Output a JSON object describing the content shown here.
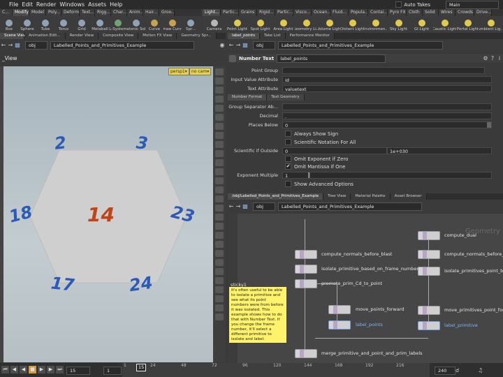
{
  "menu": {
    "items": [
      "File",
      "Edit",
      "Render",
      "Windows",
      "Assets",
      "Help"
    ],
    "auto_takes": "Auto Takes",
    "desktop": "Main"
  },
  "shelf_tabs_left": [
    "C...",
    "Modify",
    "Model",
    "Poly...",
    "Deform",
    "Text...",
    "Rigg...",
    "Char...",
    "Anim...",
    "Hair...",
    "Groo..."
  ],
  "shelf_tabs_right": [
    "Light...",
    "Partic...",
    "Grains",
    "Rigid...",
    "Partic...",
    "Visco...",
    "Ocean...",
    "Fluid...",
    "Popula...",
    "Contai...",
    "Pyro FX",
    "Cloth",
    "Solid",
    "Wires",
    "Crowds",
    "Drive..."
  ],
  "tools_left": [
    {
      "label": "Box",
      "color": "#8fa2b8"
    },
    {
      "label": "Sphere",
      "color": "#8fa2b8"
    },
    {
      "label": "Tube",
      "color": "#8fa2b8"
    },
    {
      "label": "Torus",
      "color": "#8fa2b8"
    },
    {
      "label": "Grid",
      "color": "#8fa2b8"
    },
    {
      "label": "Metaball",
      "color": "#8fa2b8"
    },
    {
      "label": "L-System",
      "color": "#6fa36f"
    },
    {
      "label": "Platonic Sol...",
      "color": "#8fa2b8"
    },
    {
      "label": "Curve",
      "color": "#c7a34a"
    },
    {
      "label": "Draw Curve",
      "color": "#c7a34a"
    },
    {
      "label": "Spr...",
      "color": "#8fa2b8"
    }
  ],
  "tools_right": [
    {
      "label": "Camera",
      "color": "#b8b8b8"
    },
    {
      "label": "Point Light",
      "color": "#e2c84c"
    },
    {
      "label": "Spot Light",
      "color": "#e2c84c"
    },
    {
      "label": "Area Light",
      "color": "#e2c84c"
    },
    {
      "label": "Geometry Li...",
      "color": "#e2c84c"
    },
    {
      "label": "Volume Light",
      "color": "#e2c84c"
    },
    {
      "label": "Distant Light",
      "color": "#e2c84c"
    },
    {
      "label": "Environmen...",
      "color": "#e2c84c"
    },
    {
      "label": "Sky Light",
      "color": "#e2c84c"
    },
    {
      "label": "GI Light",
      "color": "#e2c84c"
    },
    {
      "label": "Caustic Light",
      "color": "#e2c84c"
    },
    {
      "label": "Portal Light",
      "color": "#e2c84c"
    },
    {
      "label": "Ambient Lig...",
      "color": "#e2c84c"
    }
  ],
  "left_pane": {
    "tabs": [
      "Scene View",
      "Animation Edit...",
      "Render View",
      "Composite View",
      "Motion FX View",
      "Geometry Spr..."
    ],
    "network_path": "obj",
    "path_text": "Labelled_Points_and_Primitives_Example",
    "view_title": "_View",
    "persp": "persp1▾",
    "cam": "no cam▾"
  },
  "viewport": {
    "center_label": "14",
    "point_labels": [
      "2",
      "3",
      "18",
      "23",
      "17",
      "24"
    ],
    "center_color": "#c0441a",
    "point_color": "#2c5ab5"
  },
  "right_top": {
    "tabs": [
      "label_points",
      "Take List",
      "Performance Monitor"
    ],
    "network_path": "obj",
    "path_text": "Labelled_Points_and_Primitives_Example",
    "node_type": "Number Text",
    "node_name": "label_points",
    "params": {
      "point_group_label": "Point Group",
      "point_group_value": "",
      "input_attr_label": "Input Value Attribute",
      "input_attr_value": "id",
      "text_attr_label": "Text Attribute",
      "text_attr_value": "valuetext",
      "subtabs": [
        "Number Format",
        "Text Geometry"
      ],
      "group_sep_label": "Group Separator Ab...",
      "group_sep_value": "",
      "decimal_label": "Decimal",
      "decimal_value": ".",
      "places_below_label": "Places Below",
      "places_below_value": "0",
      "always_show_sign": "Always Show Sign",
      "sci_for_all": "Scientific Notation For All",
      "sci_outside_label": "Scientific if Outside",
      "sci_outside_min": "0",
      "sci_outside_max": "1e+030",
      "omit_exp_zero": "Omit Exponent if Zero",
      "omit_mantissa_one": "Omit Mantissa if One",
      "omit_mantissa_checked": "✔",
      "exp_multiple_label": "Exponent Multiple",
      "exp_multiple_value": "1",
      "show_advanced": "Show Advanced Options"
    }
  },
  "right_bottom": {
    "tabs": [
      "/obj/Labelled_Points_and_Primitives_Example",
      "Tree View",
      "Material Palette",
      "Asset Browser"
    ],
    "network_path": "obj",
    "path_text": "Labelled_Points_and_Primitives_Example",
    "watermark": "Geometry",
    "nodes": {
      "compute_dual": "compute_dual",
      "normals_left": "compute_normals_before_blast",
      "normals_right": "compute_normals_before_blast",
      "isolate_left": "isolate_primitive_based_on_frame_number",
      "isolate_right": "isolate_primitives_point_based_on_frame",
      "promote": "promote_prim_Cd_to_point",
      "move_points": "move_points_forward",
      "move_prims": "move_primitives_point_forward",
      "label_points": "label_points",
      "label_primitive": "label_primitive",
      "merge": "merge_primitive_and_point_and_prim_labels"
    },
    "sticky_title": "sticky1",
    "sticky_text": "It's often useful to be able to isolate a primitive and see what its point numbers were from before it was isolated. This example shows how to do that with Number Text. If you change the frame number, it'll select a different primitive to isolate and label."
  },
  "timeline": {
    "current_frame": "15",
    "start_frame": "1",
    "frame_field": "15",
    "end_frame": "240",
    "ticks": [
      "1",
      "24",
      "48",
      "72",
      "96",
      "120",
      "144",
      "168",
      "192",
      "216"
    ]
  }
}
